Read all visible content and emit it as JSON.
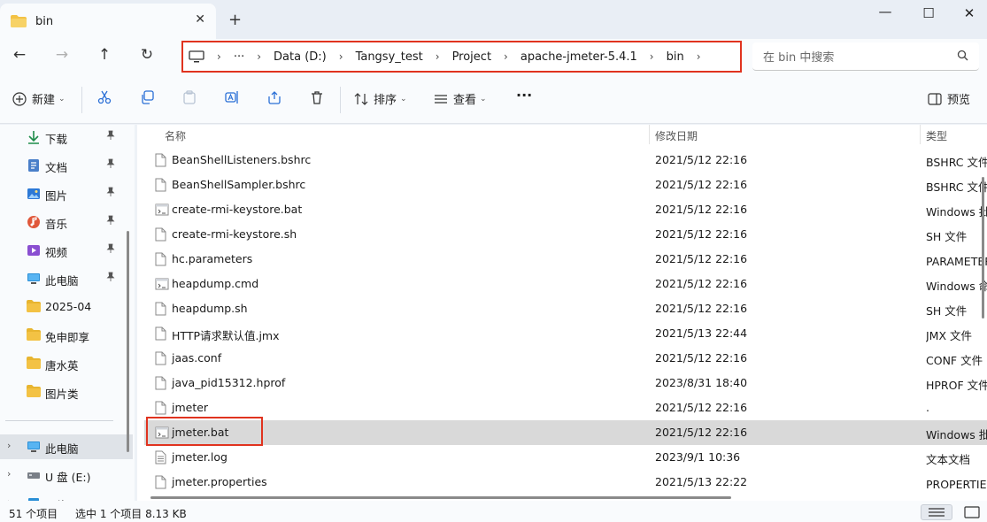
{
  "window": {
    "tab_title": "bin",
    "tab_close": "✕",
    "new_tab": "+",
    "minimize": "—",
    "maximize": "☐",
    "close": "✕"
  },
  "nav": {
    "back_icon": "←",
    "forward_icon": "→",
    "up_icon": "↑",
    "refresh_icon": "↻",
    "more": "···",
    "breadcrumb": [
      "Data (D:)",
      "Tangsy_test",
      "Project",
      "apache-jmeter-5.4.1",
      "bin"
    ],
    "separator": "›",
    "search_placeholder": "在 bin 中搜索"
  },
  "commands": {
    "new_label": "新建",
    "sort_label": "排序",
    "view_label": "查看",
    "more": "···",
    "preview_label": "预览",
    "icons": [
      "cut-icon",
      "copy-icon",
      "paste-icon",
      "rename-icon",
      "share-icon",
      "delete-icon"
    ]
  },
  "sidebar": {
    "quick_access": [
      {
        "label": "下载",
        "icon": "download-icon",
        "pinned": true
      },
      {
        "label": "文档",
        "icon": "document-icon",
        "pinned": true
      },
      {
        "label": "图片",
        "icon": "pictures-icon",
        "pinned": true
      },
      {
        "label": "音乐",
        "icon": "music-icon",
        "pinned": true
      },
      {
        "label": "视频",
        "icon": "video-icon",
        "pinned": true
      },
      {
        "label": "此电脑",
        "icon": "computer-icon",
        "pinned": true
      },
      {
        "label": "2025-04",
        "icon": "folder-icon",
        "pinned": false
      },
      {
        "label": "免申即享",
        "icon": "folder-icon",
        "pinned": false
      },
      {
        "label": "唐水英",
        "icon": "folder-icon",
        "pinned": false
      },
      {
        "label": "图片类",
        "icon": "folder-icon",
        "pinned": false
      }
    ],
    "tree": [
      {
        "label": "此电脑",
        "icon": "computer-icon",
        "selected": true
      },
      {
        "label": "U 盘 (E:)",
        "icon": "usb-drive-icon",
        "selected": false
      },
      {
        "label": "网络",
        "icon": "network-icon",
        "selected": false
      }
    ],
    "pin_glyph": "📌",
    "chevron": "›"
  },
  "list": {
    "columns": {
      "name": "名称",
      "modified": "修改日期",
      "type": "类型"
    },
    "sort_indicator": "⌃",
    "files": [
      {
        "name": "BeanShellListeners.bshrc",
        "modified": "2021/5/12 22:16",
        "type": "BSHRC 文件",
        "icon": "file-icon"
      },
      {
        "name": "BeanShellSampler.bshrc",
        "modified": "2021/5/12 22:16",
        "type": "BSHRC 文件",
        "icon": "file-icon"
      },
      {
        "name": "create-rmi-keystore.bat",
        "modified": "2021/5/12 22:16",
        "type": "Windows 批处理文件",
        "icon": "batch-file-icon"
      },
      {
        "name": "create-rmi-keystore.sh",
        "modified": "2021/5/12 22:16",
        "type": "SH 文件",
        "icon": "file-icon"
      },
      {
        "name": "hc.parameters",
        "modified": "2021/5/12 22:16",
        "type": "PARAMETERS 文件",
        "icon": "file-icon"
      },
      {
        "name": "heapdump.cmd",
        "modified": "2021/5/12 22:16",
        "type": "Windows 命令脚本",
        "icon": "batch-file-icon"
      },
      {
        "name": "heapdump.sh",
        "modified": "2021/5/12 22:16",
        "type": "SH 文件",
        "icon": "file-icon"
      },
      {
        "name": "HTTP请求默认值.jmx",
        "modified": "2021/5/13 22:44",
        "type": "JMX 文件",
        "icon": "file-icon"
      },
      {
        "name": "jaas.conf",
        "modified": "2021/5/12 22:16",
        "type": "CONF 文件",
        "icon": "file-icon"
      },
      {
        "name": "java_pid15312.hprof",
        "modified": "2023/8/31 18:40",
        "type": "HPROF 文件",
        "icon": "file-icon"
      },
      {
        "name": "jmeter",
        "modified": "2021/5/12 22:16",
        "type": ".",
        "icon": "file-icon"
      },
      {
        "name": "jmeter.bat",
        "modified": "2021/5/12 22:16",
        "type": "Windows 批处理文件",
        "icon": "batch-file-icon",
        "selected": true
      },
      {
        "name": "jmeter.log",
        "modified": "2023/9/1 10:36",
        "type": "文本文档",
        "icon": "text-file-icon"
      },
      {
        "name": "jmeter.properties",
        "modified": "2021/5/13 22:22",
        "type": "PROPERTIES 文件",
        "icon": "file-icon"
      }
    ]
  },
  "status": {
    "item_count": "51 个项目",
    "selection": "选中 1 个项目  8.13 KB"
  },
  "colors": {
    "highlight_red": "#e0331f",
    "folder_yellow": "#f3c244",
    "accent_blue": "#2a6fd6"
  }
}
